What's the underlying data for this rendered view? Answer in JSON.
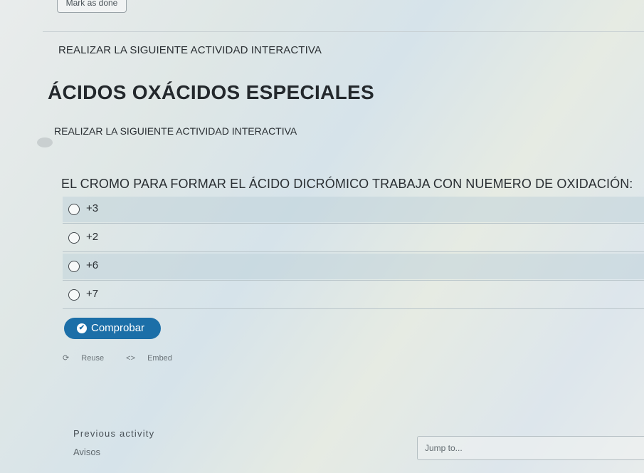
{
  "header": {
    "mark_done_label": "Mark as done"
  },
  "content": {
    "intro_top": "REALIZAR LA SIGUIENTE ACTIVIDAD INTERACTIVA",
    "title": "ÁCIDOS OXÁCIDOS ESPECIALES",
    "intro_bottom": "REALIZAR LA SIGUIENTE ACTIVIDAD INTERACTIVA"
  },
  "quiz": {
    "question": "EL CROMO PARA FORMAR EL ÁCIDO DICRÓMICO TRABAJA CON NUEMERO DE OXIDACIÓN:",
    "options": [
      "+3",
      "+2",
      "+6",
      "+7"
    ],
    "submit_label": "Comprobar",
    "submit_icon": "check-circle-icon",
    "reuse_label": "Reuse",
    "embed_label": "Embed"
  },
  "navigation": {
    "previous_label": "Previous activity",
    "previous_name": "Avisos",
    "jump_placeholder": "Jump to..."
  },
  "colors": {
    "accent": "#1c6fa8",
    "text": "#2a2f33"
  }
}
